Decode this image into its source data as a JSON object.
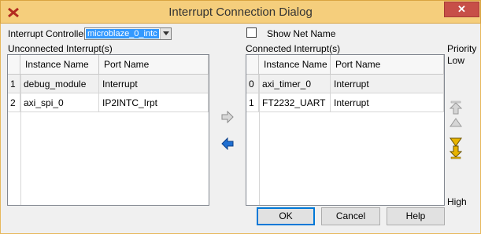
{
  "window": {
    "title": "Interrupt Connection Dialog",
    "close_label": "✕",
    "icon": "xilinx-app-icon"
  },
  "controller": {
    "label": "Interrupt Controller",
    "value": "microblaze_0_intc"
  },
  "show_net_name": {
    "label": "Show Net Name",
    "checked": false
  },
  "unconnected": {
    "title": "Unconnected Interrupt(s)",
    "columns": [
      "Instance Name",
      "Port Name"
    ],
    "rows": [
      {
        "index": "1",
        "instance": "debug_module",
        "port": "Interrupt"
      },
      {
        "index": "2",
        "instance": "axi_spi_0",
        "port": "IP2INTC_Irpt"
      }
    ]
  },
  "connected": {
    "title": "Connected Interrupt(s)",
    "columns": [
      "Instance Name",
      "Port Name"
    ],
    "rows": [
      {
        "index": "0",
        "instance": "axi_timer_0",
        "port": "Interrupt"
      },
      {
        "index": "1",
        "instance": "FT2232_UART",
        "port": "Interrupt"
      }
    ]
  },
  "priority": {
    "label": "Priority",
    "low": "Low",
    "high": "High"
  },
  "buttons": {
    "ok": "OK",
    "cancel": "Cancel",
    "help": "Help"
  },
  "icons": {
    "move_right": "move-right-arrow-icon",
    "move_left": "move-left-arrow-icon",
    "move_top": "move-to-top-icon",
    "move_up": "move-up-icon",
    "move_down": "move-down-icon",
    "move_bottom": "move-to-bottom-icon"
  },
  "colors": {
    "titlebar": "#f5ce7c",
    "close": "#c74f48",
    "selection": "#3399ff",
    "arrow_left": "#1f6fd1",
    "arrow_down": "#e8b400"
  }
}
